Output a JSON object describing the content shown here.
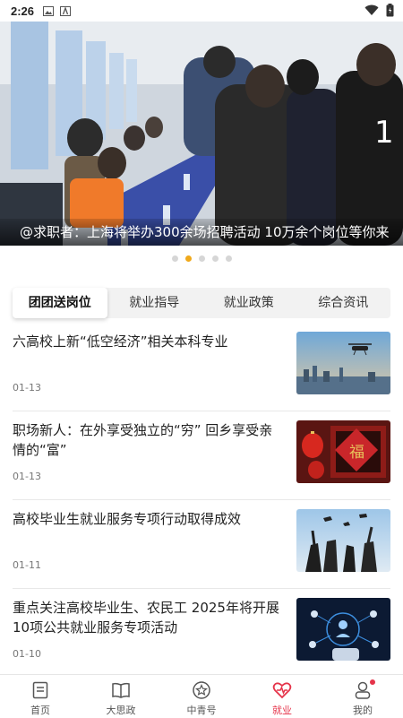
{
  "status_bar": {
    "time": "2:26"
  },
  "banner": {
    "caption": "@求职者：上海将举办300余场招聘活动 10万余个岗位等你来",
    "dots_total": 5,
    "active_dot": 1
  },
  "tabs": [
    {
      "label": "团团送岗位",
      "active": true
    },
    {
      "label": "就业指导",
      "active": false
    },
    {
      "label": "就业政策",
      "active": false
    },
    {
      "label": "综合资讯",
      "active": false
    }
  ],
  "news": [
    {
      "title": "六高校上新“低空经济”相关本科专业",
      "date": "01-13",
      "thumb": "drone-city-photo"
    },
    {
      "title": "职场新人：在外享受独立的“穷” 回乡享受亲情的“富”",
      "date": "01-13",
      "thumb": "spring-festival-fu-photo"
    },
    {
      "title": "高校毕业生就业服务专项行动取得成效",
      "date": "01-11",
      "thumb": "graduation-caps-photo"
    },
    {
      "title": "重点关注高校毕业生、农民工 2025年将开展10项公共就业服务专项活动",
      "date": "01-10",
      "thumb": "job-network-photo"
    }
  ],
  "bottom_nav": [
    {
      "label": "首页",
      "icon": "home-icon",
      "active": false
    },
    {
      "label": "大思政",
      "icon": "book-icon",
      "active": false
    },
    {
      "label": "中青号",
      "icon": "star-circle-icon",
      "active": false
    },
    {
      "label": "就业",
      "icon": "heart-icon",
      "active": true
    },
    {
      "label": "我的",
      "icon": "profile-icon",
      "active": false,
      "badge": true
    }
  ],
  "colors": {
    "accent": "#e5344a",
    "dot_active": "#f0a91b"
  }
}
